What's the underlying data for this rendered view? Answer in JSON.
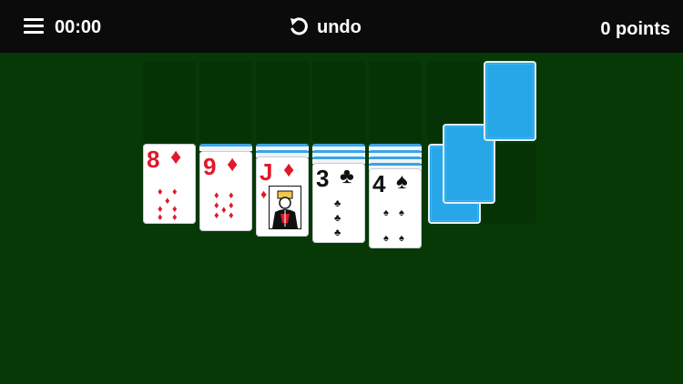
{
  "header": {
    "timer": "00:00",
    "undo_label": "undo",
    "points": "0 points"
  },
  "tableau": [
    {
      "rank": "8",
      "suit": "♦",
      "color": "red"
    },
    {
      "rank": "9",
      "suit": "♦",
      "color": "red"
    },
    {
      "rank": "J",
      "suit": "♦",
      "color": "red"
    },
    {
      "rank": "3",
      "suit": "♣",
      "color": "black"
    },
    {
      "rank": "4",
      "suit": "♠",
      "color": "black"
    }
  ],
  "colors": {
    "felt": "#063906",
    "topbar": "#0b0b0b",
    "card_back": "#27a7e8",
    "red_suit": "#e0192b"
  }
}
